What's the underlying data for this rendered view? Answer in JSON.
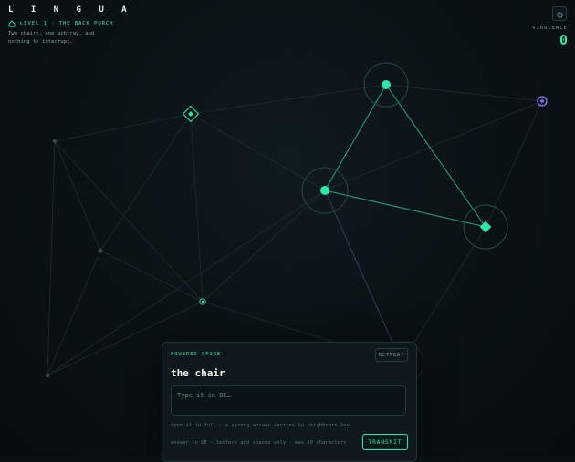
{
  "header": {
    "brand": "L I N G U A",
    "level": "LEVEL 1 · THE BACK PORCH",
    "subtitle": "Two chairs, one ashtray, and\nnothing to interrupt."
  },
  "stats": {
    "virulence_label": "VIRULENCE",
    "virulence_value": "0"
  },
  "panel": {
    "label": "POWERED SPORE",
    "retreat_label": "RETREAT",
    "word": "the chair",
    "input_placeholder": "Type it in DE…",
    "input_value": "",
    "hint": "type it in full · a strong answer carries to neighbours too",
    "rules": "answer in DE · letters and spaces only · max 20 characters",
    "transmit_label": "TRANSMIT"
  },
  "colors": {
    "accent": "#2ee6a8",
    "purple": "#8c7cff",
    "background": "#0a1115"
  },
  "icons": {
    "home": "home-icon",
    "settings": "settings-icon"
  }
}
